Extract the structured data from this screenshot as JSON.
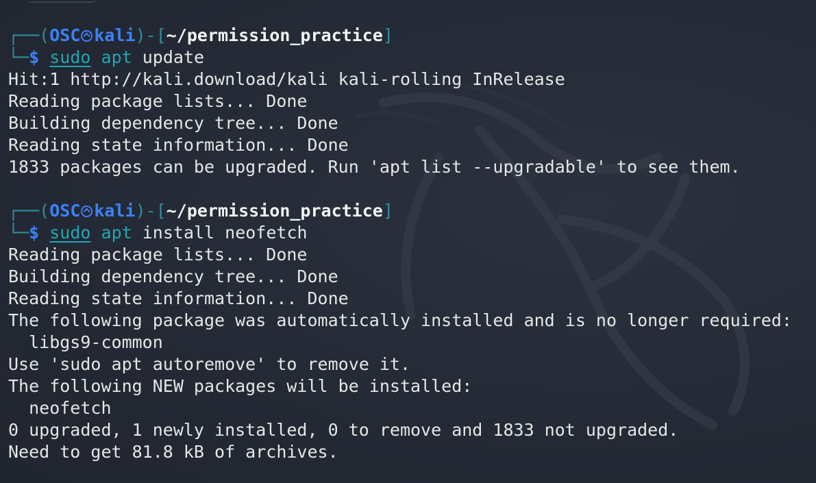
{
  "prompts": [
    {
      "frame_open": "┌──(",
      "user": "OSC",
      "host": "kali",
      "frame_mid": ")-[",
      "path": "~/permission_practice",
      "frame_close": "]",
      "frame_bottom": "└─",
      "dollar": "$",
      "sudo": "sudo",
      "apt": "apt",
      "args": "update"
    },
    {
      "frame_open": "┌──(",
      "user": "OSC",
      "host": "kali",
      "frame_mid": ")-[",
      "path": "~/permission_practice",
      "frame_close": "]",
      "frame_bottom": "└─",
      "dollar": "$",
      "sudo": "sudo",
      "apt": "apt",
      "args": "install neofetch"
    }
  ],
  "output_update": [
    "Hit:1 http://kali.download/kali kali-rolling InRelease",
    "Reading package lists... Done",
    "Building dependency tree... Done",
    "Reading state information... Done",
    "1833 packages can be upgraded. Run 'apt list --upgradable' to see them."
  ],
  "output_install": [
    "Reading package lists... Done",
    "Building dependency tree... Done",
    "Reading state information... Done",
    "The following package was automatically installed and is no longer required:",
    "  libgs9-common",
    "Use 'sudo apt autoremove' to remove it.",
    "The following NEW packages will be installed:",
    "  neofetch",
    "0 upgraded, 1 newly installed, 0 to remove and 1833 not upgraded.",
    "Need to get 81.8 kB of archives."
  ],
  "colors": {
    "background": "#232935",
    "frame": "#2f8f9d",
    "user_host": "#3b82f6",
    "command": "#22a6b3",
    "text": "#e6e6e6"
  },
  "icons": {
    "prompt_separator": "kali-dragon-icon",
    "wallpaper": "kali-dragon-watermark"
  }
}
